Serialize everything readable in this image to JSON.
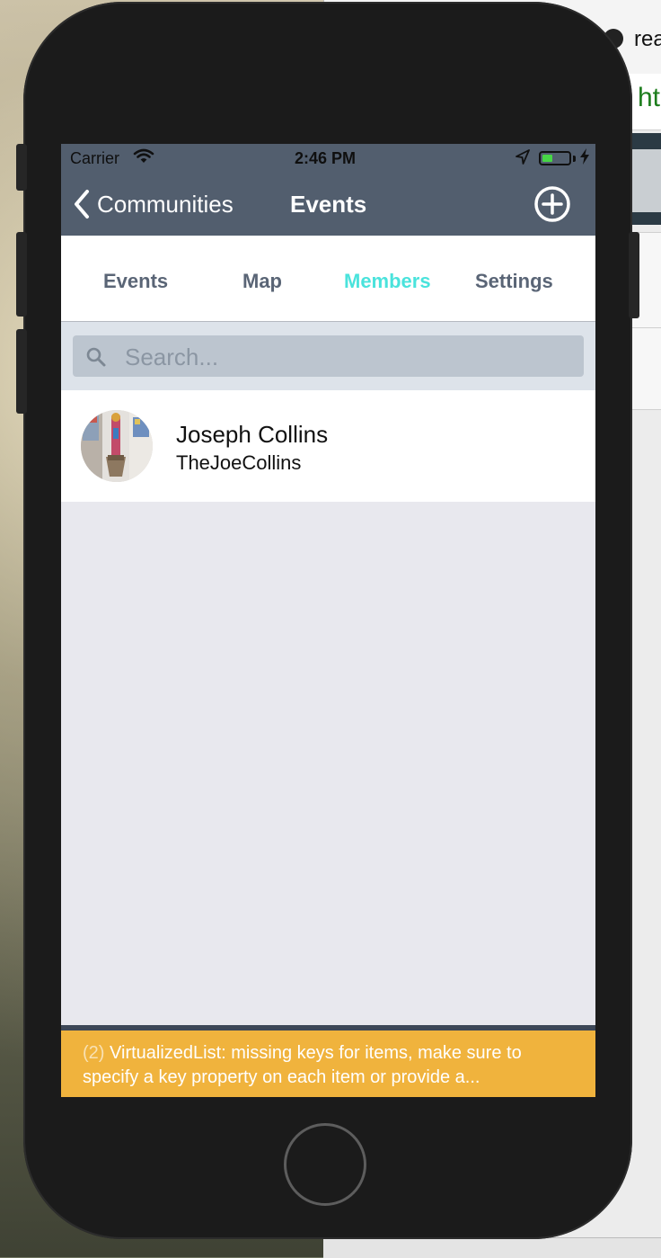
{
  "browser": {
    "tab_text": "rea",
    "url_text": "ht"
  },
  "status_bar": {
    "carrier": "Carrier",
    "time": "2:46 PM",
    "battery_level_percent": 40,
    "icons": [
      "wifi-icon",
      "location-arrow-icon",
      "battery-icon",
      "charging-bolt-icon"
    ]
  },
  "nav_bar": {
    "back_label": "Communities",
    "title": "Events",
    "action_icon": "plus-circle-icon"
  },
  "tabs": [
    {
      "label": "Events",
      "active": false
    },
    {
      "label": "Map",
      "active": false
    },
    {
      "label": "Members",
      "active": true
    },
    {
      "label": "Settings",
      "active": false
    }
  ],
  "search": {
    "placeholder": "Search...",
    "value": ""
  },
  "members": [
    {
      "name": "Joseph Collins",
      "username": "TheJoeCollins",
      "avatar": "photo"
    }
  ],
  "warning": {
    "count": "(2)",
    "message": "VirtualizedList: missing keys for items, make sure to specify a key property on each item or provide a..."
  },
  "colors": {
    "nav_bg": "#525e6e",
    "tab_active": "#4ae3dc",
    "tab_inactive": "#5a6576",
    "search_bg": "#bcc5cf",
    "warning_bg": "#f0b33d",
    "battery_fill": "#47d646"
  }
}
